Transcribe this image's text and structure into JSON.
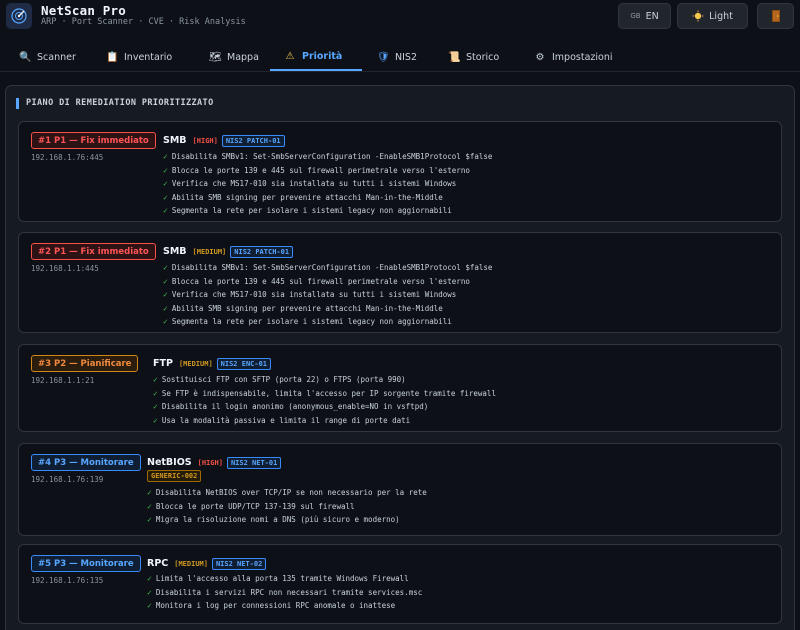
{
  "app": {
    "title": "NetScan Pro",
    "subtitle": "ARP · Port Scanner · CVE · Risk Analysis",
    "language_label": "EN",
    "language_flag": "GB",
    "theme_label": "Light",
    "theme_icon": "sun-icon",
    "exit_icon": "door-icon"
  },
  "tabs": [
    {
      "label": "Scanner",
      "icon": "magnifier-icon"
    },
    {
      "label": "Inventario",
      "icon": "clipboard-icon"
    },
    {
      "label": "Mappa",
      "icon": "map-icon"
    },
    {
      "label": "Priorità",
      "icon": "warning-icon",
      "active": true
    },
    {
      "label": "NIS2",
      "icon": "shield-icon"
    },
    {
      "label": "Storico",
      "icon": "scroll-icon"
    },
    {
      "label": "Impostazioni",
      "icon": "gear-icon"
    }
  ],
  "panel_title": "PIANO DI REMEDIATION PRIORITIZZATO",
  "items": [
    {
      "badge": "#1 P1 — Fix immediato",
      "level": "p1",
      "host": "192.168.1.76:445",
      "service": "SMB",
      "severity": "[HIGH]",
      "tag": "NIS2 PATCH-01",
      "steps": [
        "Disabilita SMBv1: Set-SmbServerConfiguration -EnableSMB1Protocol $false",
        "Blocca le porte 139 e 445 sul firewall perimetrale verso l'esterno",
        "Verifica che MS17-010 sia installata su tutti i sistemi Windows",
        "Abilita SMB signing per prevenire attacchi Man-in-the-Middle",
        "Segmenta la rete per isolare i sistemi legacy non aggiornabili"
      ]
    },
    {
      "badge": "#2 P1 — Fix immediato",
      "level": "p1",
      "host": "192.168.1.1:445",
      "service": "SMB",
      "severity": "[MEDIUM]",
      "tag": "NIS2 PATCH-01",
      "steps": [
        "Disabilita SMBv1: Set-SmbServerConfiguration -EnableSMB1Protocol $false",
        "Blocca le porte 139 e 445 sul firewall perimetrale verso l'esterno",
        "Verifica che MS17-010 sia installata su tutti i sistemi Windows",
        "Abilita SMB signing per prevenire attacchi Man-in-the-Middle",
        "Segmenta la rete per isolare i sistemi legacy non aggiornabili"
      ]
    },
    {
      "badge": "#3 P2 — Pianificare",
      "level": "p2",
      "host": "192.168.1.1:21",
      "service": "FTP",
      "severity": "[MEDIUM]",
      "tag": "NIS2 ENC-01",
      "steps": [
        "Sostituisci FTP con SFTP (porta 22) o FTPS (porta 990)",
        "Se FTP è indispensabile, limita l'accesso per IP sorgente tramite firewall",
        "Disabilita il login anonimo (anonymous_enable=NO in vsftpd)",
        "Usa la modalità passiva e limita il range di porte dati"
      ]
    },
    {
      "badge": "#4 P3 — Monitorare",
      "level": "p3",
      "host": "192.168.1.76:139",
      "service": "NetBIOS",
      "severity": "[HIGH]",
      "tag": "NIS2 NET-01",
      "extra_tag": "GENERIC-002",
      "steps": [
        "Disabilita NetBIOS over TCP/IP se non necessario per la rete",
        "Blocca le porte UDP/TCP 137-139 sul firewall",
        "Migra la risoluzione nomi a DNS (più sicuro e moderno)"
      ]
    },
    {
      "badge": "#5 P3 — Monitorare",
      "level": "p3",
      "host": "192.168.1.76:135",
      "service": "RPC",
      "severity": "[MEDIUM]",
      "tag": "NIS2 NET-02",
      "steps": [
        "Limita l'accesso alla porta 135 tramite Windows Firewall",
        "Disabilita i servizi RPC non necessari tramite services.msc",
        "Monitora i log per connessioni RPC anomale o inattese"
      ]
    }
  ]
}
